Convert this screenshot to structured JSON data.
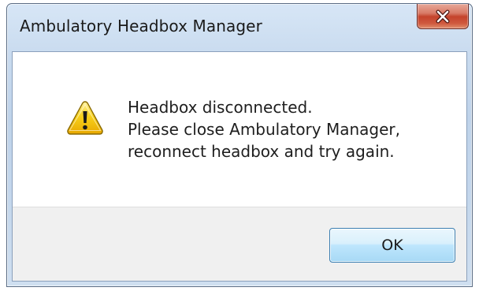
{
  "window": {
    "title": "Ambulatory Headbox Manager"
  },
  "dialog": {
    "icon": "warning-icon",
    "message_lines": [
      "Headbox disconnected.",
      "Please close Ambulatory Manager,",
      "reconnect headbox and try again."
    ],
    "ok_label": "OK"
  },
  "colors": {
    "title_bar": "#c4d7ec",
    "close_button": "#c4432c",
    "ok_button_border": "#3c7fb1",
    "footer_background": "#f0f0f0",
    "warning_yellow": "#f5c400"
  }
}
